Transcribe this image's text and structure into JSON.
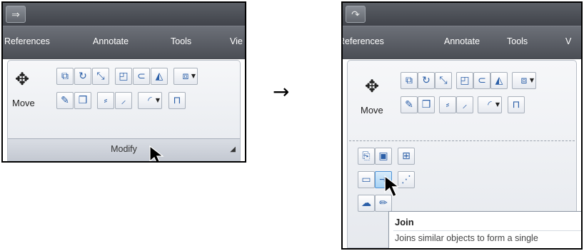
{
  "left": {
    "tabs": [
      "References",
      "Annotate",
      "Tools",
      "Vie"
    ],
    "move_label": "Move",
    "panel_title": "Modify"
  },
  "right": {
    "tabs": [
      "References",
      "Annotate",
      "Tools",
      "V"
    ],
    "move_label": "Move",
    "tooltip": {
      "title": "Join",
      "description": "Joins similar objects to form a single"
    }
  },
  "icons": {
    "move": "move-arrows-icon",
    "qat": "redo-icon",
    "row1": [
      "copy-icon",
      "rotate-icon",
      "scale-icon",
      "stretch-icon",
      "offset-icon",
      "mirror-icon",
      "array-icon"
    ],
    "row2": [
      "erase-icon",
      "explode-icon",
      "trim-icon",
      "extend-icon",
      "fillet-icon",
      "edit-polyline-icon"
    ],
    "extra": [
      "break-at-point-icon",
      "draw-order-icon",
      "array-rect-icon",
      "break-icon",
      "join-icon",
      "lengthen-icon",
      "revcloud-icon",
      "pencil-edit-icon"
    ]
  },
  "arrow_glyph": "→"
}
